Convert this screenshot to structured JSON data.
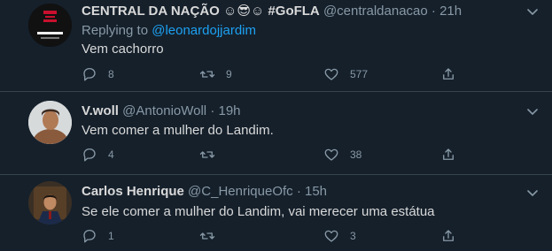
{
  "tweets": [
    {
      "name": "CENTRAL DA NAÇÃO ☺😎☺ #GoFLA",
      "handle": "@centraldanacao",
      "time": "21h",
      "replying_prefix": "Replying to",
      "replying_handle": "@leonardojjardim",
      "text": "Vem cachorro",
      "replies": "8",
      "retweets": "9",
      "likes": "577"
    },
    {
      "name": "V.woll",
      "handle": "@AntonioWoll",
      "time": "19h",
      "text": "Vem comer a mulher do Landim.",
      "replies": "4",
      "retweets": "",
      "likes": "38"
    },
    {
      "name": "Carlos Henrique",
      "handle": "@C_HenriqueOfc",
      "time": "15h",
      "text": "Se ele comer a mulher do Landim, vai merecer uma estátua",
      "replies": "1",
      "retweets": "",
      "likes": "3"
    }
  ],
  "separator": "·",
  "colors": {
    "background": "#15202b",
    "divider": "#38444d",
    "text": "#d9d9d9",
    "muted": "#8899a6",
    "link": "#1da1f2"
  }
}
